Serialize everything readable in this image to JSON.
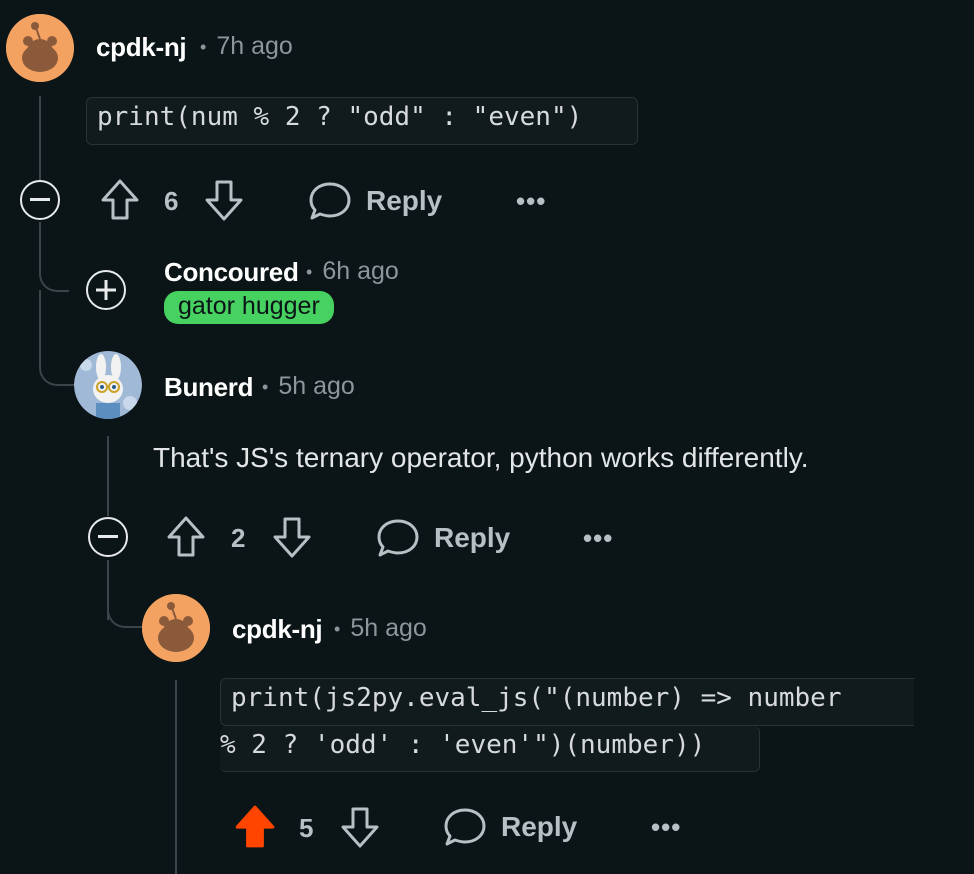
{
  "comments": [
    {
      "username": "cpdk-nj",
      "time": "7h ago",
      "code": "print(num % 2 ? \"odd\" : \"even\")",
      "votes": "6",
      "reply_label": "Reply",
      "more_label": "•••"
    },
    {
      "username": "Concoured",
      "time": "6h ago",
      "flair": "gator hugger"
    },
    {
      "username": "Bunerd",
      "time": "5h ago",
      "text": "That's JS's ternary operator, python works differently.",
      "votes": "2",
      "reply_label": "Reply",
      "more_label": "•••"
    },
    {
      "username": "cpdk-nj",
      "time": "5h ago",
      "code_line1": "print(js2py.eval_js(\"(number) => number",
      "code_line2": "% 2 ? 'odd' : 'even'\")(number))",
      "votes": "5",
      "reply_label": "Reply",
      "more_label": "•••",
      "upvoted": true
    }
  ],
  "colors": {
    "background": "#0b1416",
    "upvote_active": "#ff4500",
    "flair_bg": "#46d160",
    "snoo_avatar": "#f4a261"
  },
  "icons": [
    "snoo-avatar-icon",
    "upvote-icon",
    "downvote-icon",
    "reply-bubble-icon",
    "collapse-icon",
    "expand-icon",
    "more-dots-icon"
  ]
}
